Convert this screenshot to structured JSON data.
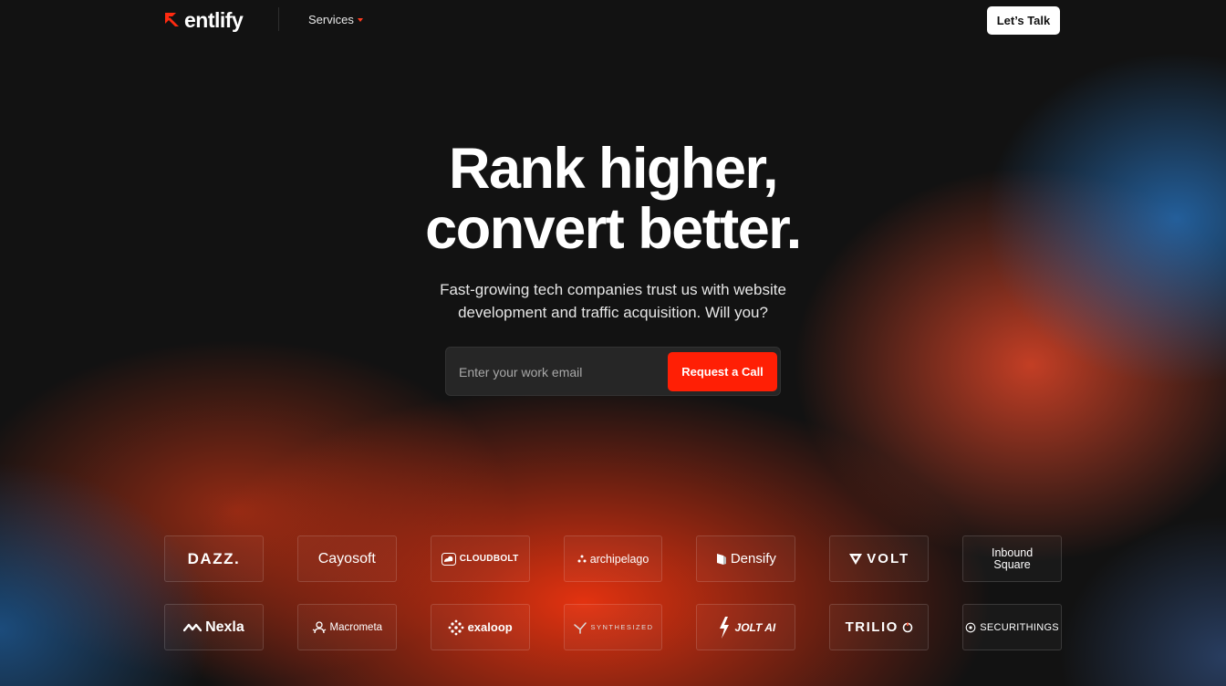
{
  "brand": {
    "name": "entlify",
    "accent": "#ff1f05"
  },
  "nav": {
    "services_label": "Services",
    "cta_label": "Let’s Talk"
  },
  "hero": {
    "title_line1": "Rank higher,",
    "title_line2": "convert better.",
    "subtitle_line1": "Fast-growing tech companies trust us with website",
    "subtitle_line2": "development and traffic acquisition. Will you?"
  },
  "form": {
    "email_placeholder": "Enter your work email",
    "email_value": "",
    "submit_label": "Request a Call"
  },
  "clients": {
    "row1": [
      {
        "name": "DAZZ.",
        "icon": ""
      },
      {
        "name": "Cayosoft",
        "icon": ""
      },
      {
        "name": "CLOUDBOLT",
        "icon": "cloudbolt-icon"
      },
      {
        "name": "archipelago",
        "icon": "archipelago-icon"
      },
      {
        "name": "Densify",
        "icon": "densify-icon"
      },
      {
        "name": "VOLT",
        "icon": "volt-icon"
      },
      {
        "name": "Inbound Square",
        "icon": ""
      }
    ],
    "row2": [
      {
        "name": "Nexla",
        "icon": "nexla-icon"
      },
      {
        "name": "Macrometa",
        "icon": "macrometa-icon"
      },
      {
        "name": "exaloop",
        "icon": "exaloop-icon"
      },
      {
        "name": "SYNTHESIZED",
        "icon": "synthesized-icon"
      },
      {
        "name": "JOLT AI",
        "icon": "jolt-icon"
      },
      {
        "name": "TRILIO",
        "icon": "trilio-icon"
      },
      {
        "name": "SECURITHINGS",
        "icon": "securithings-icon"
      }
    ]
  }
}
